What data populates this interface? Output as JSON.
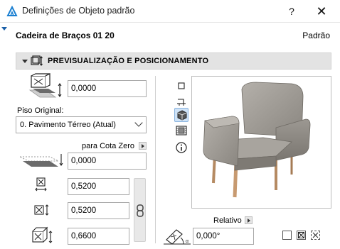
{
  "window": {
    "title": "Definições de Objeto padrão",
    "help_label": "?",
    "close_label": "✕"
  },
  "object": {
    "name": "Cadeira de Braços 01 20",
    "preset": "Padrão"
  },
  "section": {
    "title": "PREVISUALIZAÇÃO E POSICIONAMENTO"
  },
  "positioning": {
    "offset_value": "0,0000",
    "floor_label": "Piso Original:",
    "floor_selected": "0. Pavimento Térreo (Atual)",
    "zero_level_label": "para Cota Zero",
    "zero_level_value": "0,0000",
    "width_value": "0,5200",
    "depth_value": "0,5200",
    "height_value": "0,6600"
  },
  "preview": {
    "relative_label": "Relativo",
    "angle_value": "0,000°",
    "view_buttons": [
      "plan-view-icon",
      "section-view-icon",
      "3d-view-icon",
      "elevation-view-icon",
      "info-icon"
    ]
  },
  "colors": {
    "accent": "#1a5fa8",
    "header_bg": "#e3e3e3",
    "active_btn": "#cfe3f7"
  }
}
